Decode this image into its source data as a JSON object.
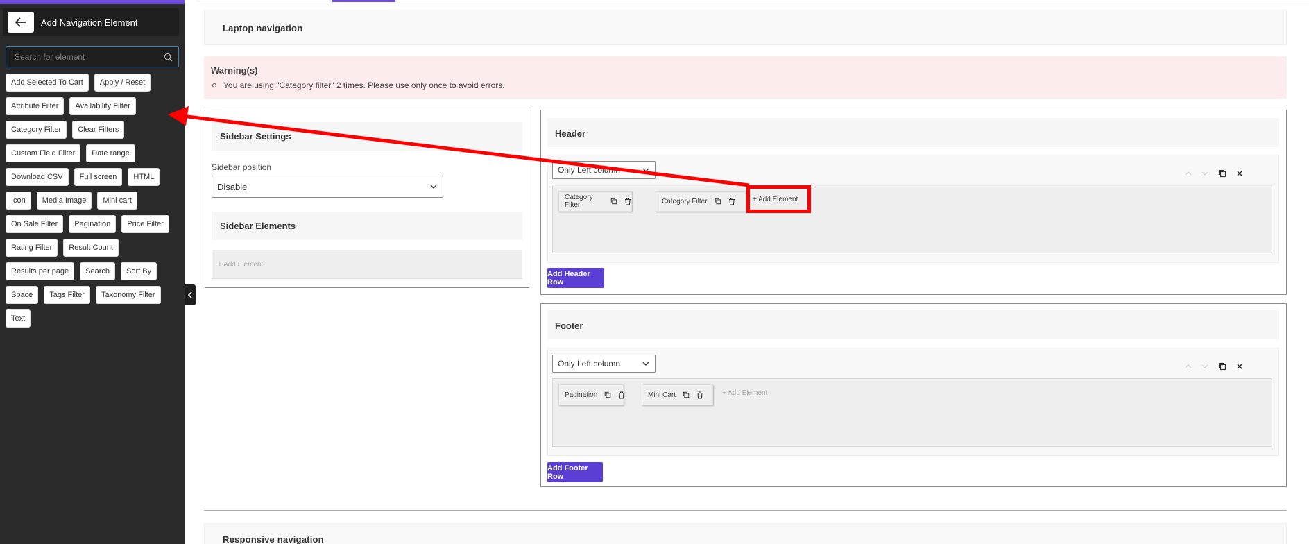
{
  "panel": {
    "title": "Add Navigation Element",
    "search_placeholder": "Search for element",
    "elements": [
      "Add Selected To Cart",
      "Apply / Reset",
      "Attribute Filter",
      "Availability Filter",
      "Category Filter",
      "Clear Filters",
      "Custom Field Filter",
      "Date range",
      "Download CSV",
      "Full screen",
      "HTML",
      "Icon",
      "Media Image",
      "Mini cart",
      "On Sale Filter",
      "Pagination",
      "Price Filter",
      "Rating Filter",
      "Result Count",
      "Results per page",
      "Search",
      "Sort By",
      "Space",
      "Tags Filter",
      "Taxonomy Filter",
      "Text"
    ]
  },
  "laptop": {
    "title": "Laptop navigation"
  },
  "warning": {
    "title": "Warning(s)",
    "items": [
      "You are using \"Category filter\" 2 times. Please use only once to avoid errors."
    ]
  },
  "sidebar_settings": {
    "title": "Sidebar Settings",
    "position_label": "Sidebar position",
    "position_value": "Disable",
    "elements_title": "Sidebar Elements",
    "add_element": "+ Add Element"
  },
  "header": {
    "title": "Header",
    "column_select": "Only Left column",
    "elements": [
      "Category Filter",
      "Category Filter"
    ],
    "add_element": "+ Add Element",
    "add_row": "Add Header Row"
  },
  "footer": {
    "title": "Footer",
    "column_select": "Only Left column",
    "elements": [
      "Pagination",
      "Mini Cart"
    ],
    "add_element": "+ Add Element",
    "add_row": "Add Footer Row"
  },
  "responsive": {
    "title": "Responsive navigation"
  },
  "colors": {
    "accent": "#5b3fd4",
    "panel_bg": "#2b2b2b",
    "annotation": "#ff0000",
    "warning_bg": "#fdecec"
  },
  "icons": [
    "arrow-left-icon",
    "search-icon",
    "chevron-left-icon",
    "chevron-down-icon",
    "copy-icon",
    "trash-icon",
    "chevron-up-icon",
    "close-icon"
  ]
}
